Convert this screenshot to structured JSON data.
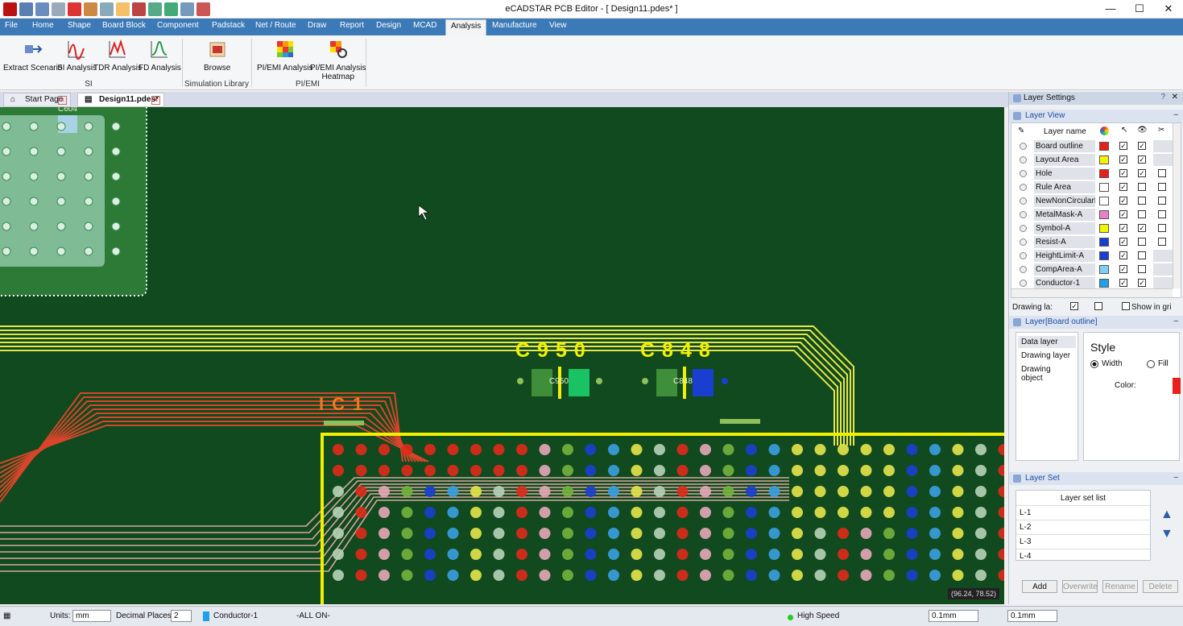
{
  "window": {
    "title": "eCADSTAR PCB Editor - [ Design11.pdes* ]",
    "min": "—",
    "max": "☐",
    "close": "✕"
  },
  "menu": [
    "File",
    "Home",
    "Shape",
    "Board Block",
    "Component",
    "Padstack",
    "Net / Route",
    "Draw",
    "Report",
    "Design",
    "MCAD",
    "Analysis",
    "Manufacture",
    "View"
  ],
  "ribbon": {
    "buttons": [
      "Extract Scenario",
      "SI Analysis",
      "TDR Analysis",
      "FD Analysis",
      "Browse",
      "PI/EMI Analysis",
      "PI/EMI Analysis",
      "Heatmap"
    ],
    "groups": [
      "SI",
      "Simulation Library",
      "PI/EMI"
    ]
  },
  "tabs": [
    "Start Page",
    "Design11.pdes*"
  ],
  "canvas": {
    "labels": [
      "C604",
      "C950",
      "C848",
      "IC1",
      "C950",
      "C848"
    ],
    "coord": "(96.24, 78.52)"
  },
  "panel": {
    "title": "Layer Settings",
    "layer_view": "Layer View",
    "col_name": "Layer name",
    "layers": [
      {
        "name": "Board outline",
        "color": "#e8201c"
      },
      {
        "name": "Layout Area",
        "color": "#f5f500"
      },
      {
        "name": "Hole",
        "color": "#e8201c"
      },
      {
        "name": "Rule Area",
        "color": "#ffffff"
      },
      {
        "name": "NewNonCircularH",
        "color": "#ffffff"
      },
      {
        "name": "MetalMask-A",
        "color": "#e87fc8"
      },
      {
        "name": "Symbol-A",
        "color": "#f5f500"
      },
      {
        "name": "Resist-A",
        "color": "#1a3fd0"
      },
      {
        "name": "HeightLimit-A",
        "color": "#1a3fd0"
      },
      {
        "name": "CompArea-A",
        "color": "#7fd0f0"
      },
      {
        "name": "Conductor-1",
        "color": "#1fa0e8"
      }
    ],
    "drawing_label": "Drawing la:",
    "show_grid": "Show in gri",
    "layer_detail": "Layer[Board outline]",
    "detail_items": [
      "Data layer",
      "Drawing layer",
      "Drawing object"
    ],
    "style": "Style",
    "width": "Width",
    "fill": "Fill",
    "color": "Color:",
    "color_value": "#e8201c",
    "layer_set": "Layer Set",
    "layer_set_list": "Layer set list",
    "sets": [
      "L-1",
      "L-2",
      "L-3",
      "L-4"
    ],
    "buttons": [
      "Add",
      "Overwrite",
      "Rename",
      "Delete"
    ]
  },
  "status": {
    "units_label": "Units:",
    "units": "mm",
    "decimal_label": "Decimal Places:",
    "decimal": "2",
    "layer": "Conductor-1",
    "all_on": "-ALL ON-",
    "high_speed": "High Speed",
    "grid1": "0.1mm",
    "grid2": "0.1mm"
  }
}
